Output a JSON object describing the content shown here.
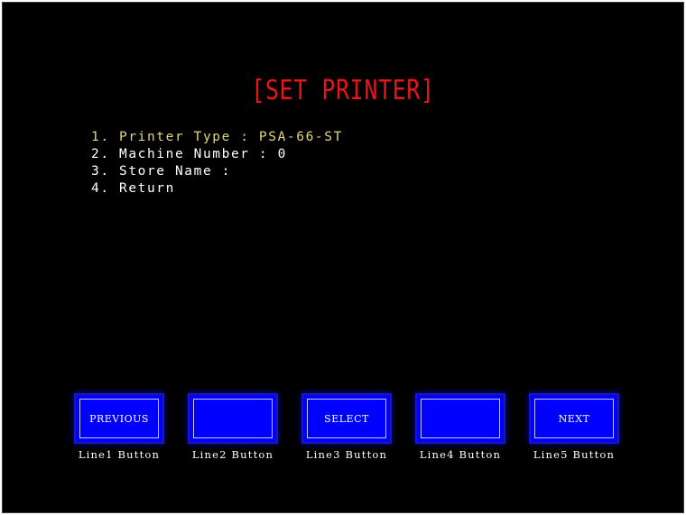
{
  "title": "[SET PRINTER]",
  "menu": {
    "items": [
      {
        "text": "1. Printer Type : PSA-66-ST",
        "selected": true
      },
      {
        "text": "2. Machine Number : 0",
        "selected": false
      },
      {
        "text": "3. Store Name :",
        "selected": false
      },
      {
        "text": "4. Return",
        "selected": false
      }
    ]
  },
  "buttons": [
    {
      "label": "PREVIOUS",
      "caption": "Line1 Button"
    },
    {
      "label": "",
      "caption": "Line2 Button"
    },
    {
      "label": "SELECT",
      "caption": "Line3 Button"
    },
    {
      "label": "",
      "caption": "Line4 Button"
    },
    {
      "label": "NEXT",
      "caption": "Line5 Button"
    }
  ],
  "colors": {
    "background": "#000000",
    "title": "#e8151b",
    "selected_item": "#e3d77d",
    "menu_text": "#ffffff",
    "button_fill": "#0000ff"
  }
}
